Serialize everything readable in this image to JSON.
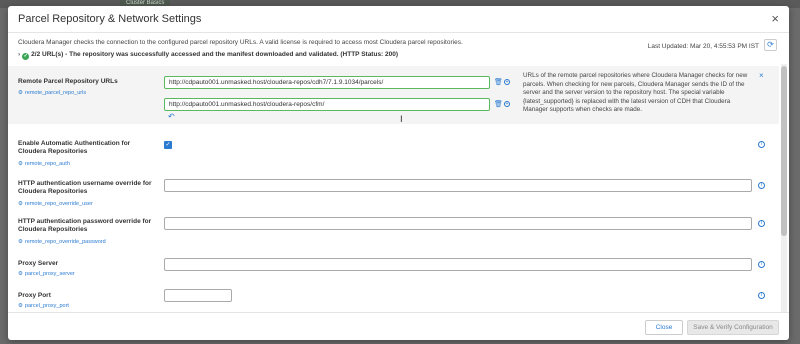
{
  "background": {
    "tab_label": "Cluster Basics"
  },
  "modal": {
    "title": "Parcel Repository & Network Settings",
    "intro": "Cloudera Manager checks the connection to the configured parcel repository URLs. A valid license is required to access most Cloudera parcel repositories.",
    "last_updated": "Last Updated: Mar 20, 4:55:53 PM IST",
    "status": "2/2 URL(s) - The repository was successfully accessed and the manifest downloaded and validated. (HTTP Status: 200)"
  },
  "settings": {
    "remote_repo": {
      "label": "Remote Parcel Repository URLs",
      "key": "remote_parcel_repo_urls",
      "urls": [
        "http://cdpauto001.unmasked.host/cloudera-repos/cdh7/7.1.9.1034/parcels/",
        "http://cdpauto001.unmasked.host/cloudera-repos/cfm/"
      ],
      "help": "URLs of the remote parcel repositories where Cloudera Manager checks for new parcels. When checking for new parcels, Cloudera Manager sends the ID of the server and the server version to the repository host. The special variable {latest_supported} is replaced with the latest version of CDH that Cloudera Manager supports when checks are made."
    },
    "auto_auth": {
      "label": "Enable Automatic Authentication for Cloudera Repositories",
      "key": "remote_repo_auth"
    },
    "http_user": {
      "label": "HTTP authentication username override for Cloudera Repositories",
      "key": "remote_repo_override_user",
      "value": ""
    },
    "http_pass": {
      "label": "HTTP authentication password override for Cloudera Repositories",
      "key": "remote_repo_override_password",
      "value": ""
    },
    "proxy_server": {
      "label": "Proxy Server",
      "key": "parcel_proxy_server",
      "value": ""
    },
    "proxy_port": {
      "label": "Proxy Port",
      "key": "parcel_proxy_port",
      "value": ""
    }
  },
  "footer": {
    "close_label": "Close",
    "save_label": "Save & Verify Configuration"
  },
  "colors": {
    "accent": "#2b7bd0",
    "success": "#3aa655",
    "valid_border": "#5cb85c"
  }
}
